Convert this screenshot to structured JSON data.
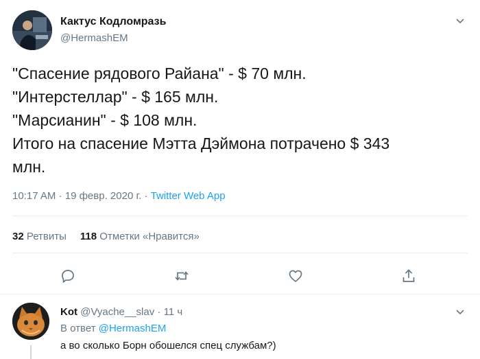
{
  "tweet": {
    "author_name": "Кактус Кодломразь",
    "author_handle": "@HermashEM",
    "lines": [
      "\"Спасение рядового Райана\" - $ 70 млн.",
      "\"Интерстеллар\" - $ 165 млн.",
      "\"Марсианин\" - $ 108 млн.",
      "Итого на спасение Мэтта Дэймона потрачено $ 343",
      "млн."
    ],
    "time": "10:17 AM",
    "sep1": " · ",
    "date": "19 февр. 2020 г.",
    "sep2": " · ",
    "app": "Twitter Web App",
    "retweets_count": "32",
    "retweets_label": "Ретвиты",
    "likes_count": "118",
    "likes_label": "Отметки «Нравится»"
  },
  "actions": {
    "reply_icon": "reply-icon",
    "retweet_icon": "retweet-icon",
    "like_icon": "heart-icon",
    "share_icon": "share-icon"
  },
  "reply": {
    "name": "Kot",
    "handle": "@Vyache__slav",
    "sep": " · ",
    "time": "11 ч",
    "reply_prefix": "В ответ ",
    "reply_to": "@HermashEM",
    "text": "а во сколько Борн обошелся спец службам?)"
  },
  "colors": {
    "accent": "#1da1f2",
    "secondary_text": "#657786",
    "divider": "#e6ecf0"
  }
}
